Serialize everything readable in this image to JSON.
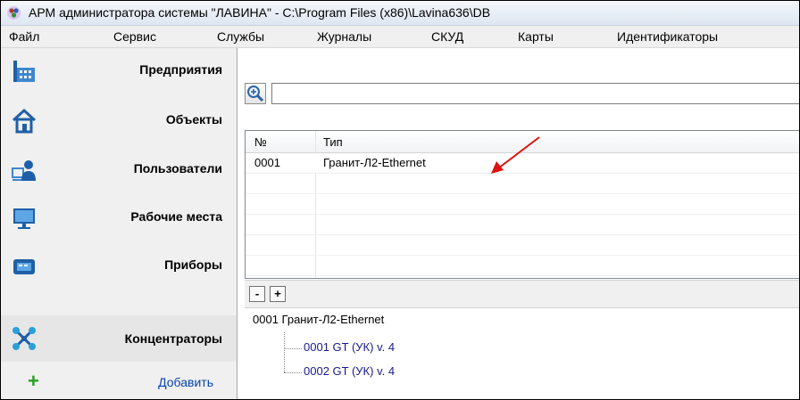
{
  "window": {
    "title": "АРМ администратора системы \"ЛАВИНА\" - C:\\Program Files (x86)\\Lavina636\\DB",
    "icon": "app-logo-icon"
  },
  "menu": {
    "items": [
      "Файл",
      "Сервис",
      "Службы",
      "Журналы",
      "СКУД",
      "Карты",
      "Идентификаторы"
    ]
  },
  "sidebar": {
    "items": [
      {
        "label": "Предприятия",
        "icon": "building-chart-icon"
      },
      {
        "label": "Объекты",
        "icon": "house-icon"
      },
      {
        "label": "Пользователи",
        "icon": "users-icon"
      },
      {
        "label": "Рабочие места",
        "icon": "monitor-icon"
      },
      {
        "label": "Приборы",
        "icon": "device-icon"
      },
      {
        "label": "Концентраторы",
        "icon": "network-hub-icon"
      }
    ],
    "selected_index": 5,
    "add_label": "Добавить",
    "add_icon": "plus-icon"
  },
  "search": {
    "button_icon": "magnifier-plus-icon",
    "value": ""
  },
  "table": {
    "columns": [
      "№",
      "Тип"
    ],
    "rows": [
      {
        "num": "0001",
        "type": "Гранит-Л2-Ethernet"
      }
    ]
  },
  "subtoolbar": {
    "collapse_label": "-",
    "expand_label": "+"
  },
  "tree": {
    "root": "0001  Гранит-Л2-Ethernet",
    "children": [
      "0001  GT (УК)  v. 4",
      "0002  GT (УК)  v. 4"
    ]
  },
  "colors": {
    "annotation_arrow": "#e01010",
    "add_plus": "#24a024",
    "link": "#0645ad",
    "tree_child_text": "#1a1a8c"
  }
}
